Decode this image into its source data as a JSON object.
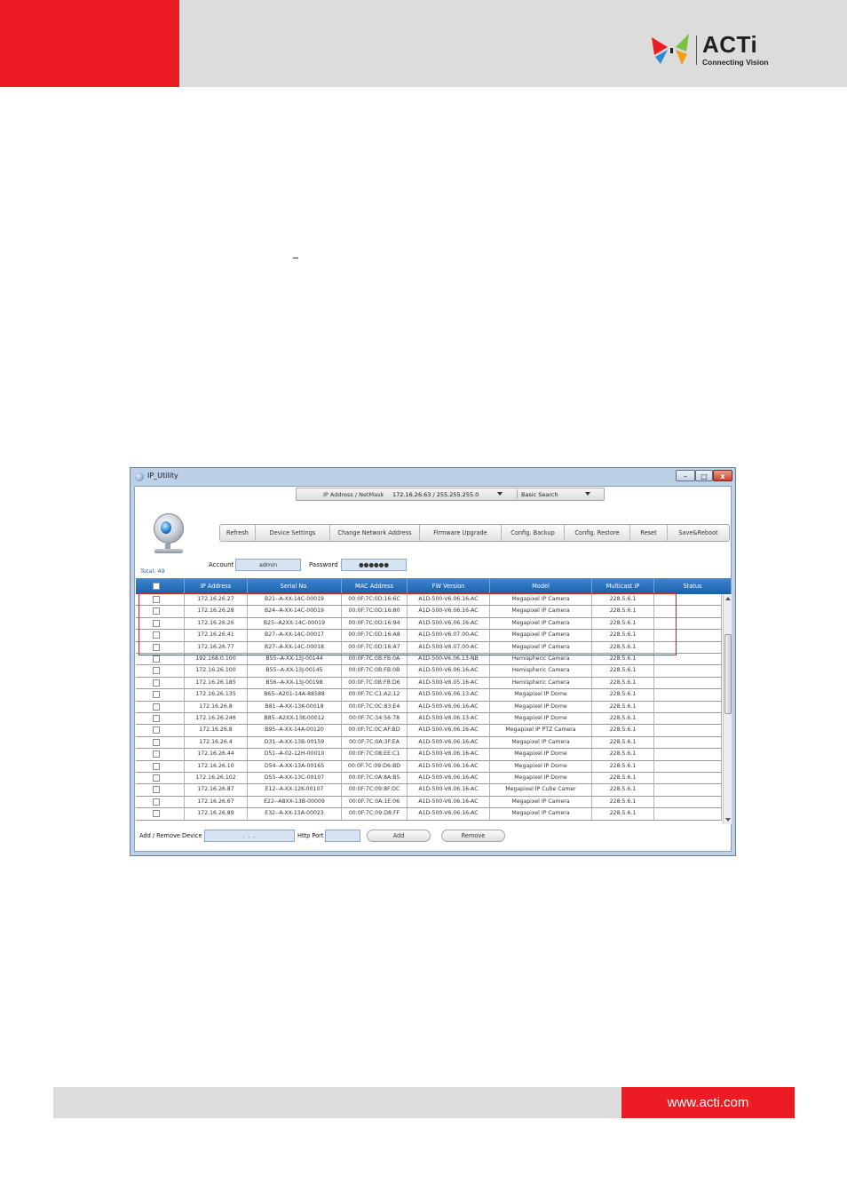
{
  "footer": {
    "url": "www.acti.com"
  },
  "logo": {
    "brand": "ACTi",
    "tagline": "Connecting Vision"
  },
  "window": {
    "title": "IP_Utility",
    "controls": {
      "minimize": "–",
      "maximize": "□",
      "close": "x"
    },
    "topbar": {
      "ip_label": "IP Address / NetMask",
      "ip_value": "172.16.26.63 / 255.255.255.0",
      "search_mode": "Basic Search"
    },
    "toolbar": [
      "Refresh",
      "Device Settings",
      "Change Network Address",
      "Firmware Upgrade",
      "Config. Backup",
      "Config. Restore",
      "Reset",
      "Save&Reboot"
    ],
    "total": "Total: 49",
    "account": {
      "label": "Account",
      "value": "admin"
    },
    "password": {
      "label": "Password",
      "value": "●●●●●●"
    },
    "columns": [
      "IP Address",
      "Serial No.",
      "MAC Address",
      "FW Version",
      "Model",
      "Multicast IP",
      "Status"
    ],
    "rows": [
      [
        "172.16.26.27",
        "B21--A-XX-14C-00019",
        "00:0F:7C:0D:16:6C",
        "A1D-500-V6.06.16-AC",
        "Megapixel IP Camera",
        "228.5.6.1",
        ""
      ],
      [
        "172.16.26.28",
        "B24--A-XX-14C-00019",
        "00:0F:7C:0D:16:80",
        "A1D-500-V6.06.16-AC",
        "Megapixel IP Camera",
        "228.5.6.1",
        ""
      ],
      [
        "172.16.26.26",
        "B25--A2XX-14C-00019",
        "00:0F:7C:0D:16:94",
        "A1D-500-V6.06.16-AC",
        "Megapixel IP Camera",
        "228.5.6.1",
        ""
      ],
      [
        "172.16.26.41",
        "B27--A-XX-14C-00017",
        "00:0F:7C:0D:16:A8",
        "A1D-500-V6.07.00-AC",
        "Megapixel IP Camera",
        "228.5.6.1",
        ""
      ],
      [
        "172.16.26.77",
        "B27--A-XX-14C-00018",
        "00:0F:7C:0D:16:A7",
        "A1D-500-V6.07.00-AC",
        "Megapixel IP Camera",
        "228.5.6.1",
        ""
      ],
      [
        "192.168.0.100",
        "B55--A-XX-13J-00144",
        "00:0F:7C:0B:FB:0A",
        "A1D-500-V6.06.13-NB",
        "Hemispheric Camera",
        "228.5.6.1",
        ""
      ],
      [
        "172.16.26.100",
        "B55--A-XX-13J-00145",
        "00:0F:7C:0B:FB:0B",
        "A1D-500-V6.06.16-AC",
        "Hemispheric Camera",
        "228.5.6.1",
        ""
      ],
      [
        "172.16.26.185",
        "B56--A-XX-13J-00198",
        "00:0F:7C:0B:FB:D6",
        "A1D-500-V6.05.16-AC",
        "Hemispheric Camera",
        "228.5.6.1",
        ""
      ],
      [
        "172.16.26.135",
        "B65--A201-14A-88588",
        "00:0F:7C:C1:A2:12",
        "A1D-500-V6.06.13-AC",
        "Megapixel IP Dome",
        "228.5.6.1",
        ""
      ],
      [
        "172.16.26.8",
        "B81--A-XX-13K-00018",
        "00:0F:7C:0C:83:E4",
        "A1D-500-V6.06.16-AC",
        "Megapixel IP Dome",
        "228.5.6.1",
        ""
      ],
      [
        "172.16.26.246",
        "B85--A2XX-13K-00012",
        "00:0F:7C:34:56:78",
        "A1D-500-V6.06.13-AC",
        "Megapixel IP Dome",
        "228.5.6.1",
        ""
      ],
      [
        "172.16.26.8",
        "B95--A-XX-14A-00120",
        "00:0F:7C:0C:AF:BD",
        "A1D-500-V6.06.16-AC",
        "Megapixel IP PTZ Camera",
        "228.5.6.1",
        ""
      ],
      [
        "172.16.26.4",
        "D31--A-XX-13B-00159",
        "00:0F:7C:0A:3F:EA",
        "A1D-500-V6.06.16-AC",
        "Megapixel IP Camera",
        "228.5.6.1",
        ""
      ],
      [
        "172.16.26.44",
        "D51--A-02-12H-00010",
        "00:0F:7C:08:EE:C1",
        "A1D-500-V6.06.16-AC",
        "Megapixel IP Dome",
        "228.5.6.1",
        ""
      ],
      [
        "172.16.26.10",
        "D54--A-XX-13A-00165",
        "00:0F:7C:09:D6:BD",
        "A1D-500-V6.06.16-AC",
        "Megapixel IP Dome",
        "228.5.6.1",
        ""
      ],
      [
        "172.16.26.102",
        "D55--A-XX-13C-00107",
        "00:0F:7C:0A:8A:B5",
        "A1D-500-V6.06.16-AC",
        "Megapixel IP Dome",
        "228.5.6.1",
        ""
      ],
      [
        "172.16.26.87",
        "E12--A-XX-12K-00107",
        "00:0F:7C:09:8F:DC",
        "A1D-500-V6.06.16-AC",
        "Megapixel IP Cube Camer",
        "228.5.6.1",
        ""
      ],
      [
        "172.16.26.67",
        "E22--A8XX-13B-00009",
        "00:0F:7C:0A:1E:06",
        "A1D-500-V6.06.16-AC",
        "Megapixel IP Camera",
        "228.5.6.1",
        ""
      ],
      [
        "172.16.26.89",
        "E32--A-XX-13A-00023",
        "00:0F:7C:09:D8:FF",
        "A1D-500-V6.06.16-AC",
        "Megapixel IP Camera",
        "228.5.6.1",
        ""
      ]
    ],
    "bottom": {
      "add_remove_label": "Add / Remove Device",
      "ip_placeholder": ".    .    .",
      "port_label": "Http Port",
      "add_button": "Add",
      "remove_button": "Remove"
    }
  }
}
